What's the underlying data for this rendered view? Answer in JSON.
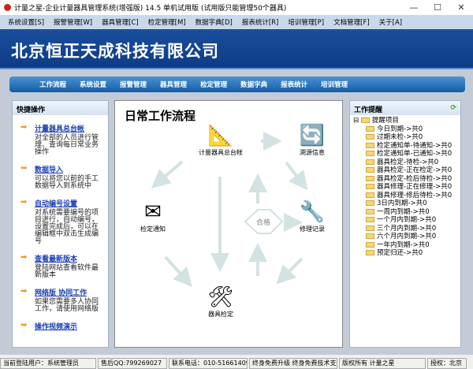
{
  "window": {
    "title": "计量之星-企业计量器具管理系统(增强版) 14.5 单机试用版  (试用版只能管理50个器具)",
    "min": "—",
    "max": "☐",
    "close": "✕"
  },
  "menu": [
    "系统设置[S]",
    "报警管理[W]",
    "器具管理[C]",
    "检定管理[M]",
    "数据字典[D]",
    "报表统计[R]",
    "培训管理[P]",
    "文档管理[F]",
    "关于[A]"
  ],
  "banner": "北京恒正天成科技有限公司",
  "nav": [
    "工作流程",
    "系统设置",
    "报警管理",
    "器具管理",
    "检定管理",
    "数据字典",
    "报表统计",
    "培训管理"
  ],
  "quick": {
    "title": "快捷操作",
    "items": [
      {
        "link": "计量器具总台帐",
        "desc": "对全部的人员进行管理、查询每日常业务操作"
      },
      {
        "link": "数据导入",
        "desc": "可以将您以前的手工数据导入到系统中"
      },
      {
        "link": "自动编号设置",
        "desc": "对系统需要编号的项目进行，自动编号，设置完成后，可以在编辑框中双击生成编号"
      },
      {
        "link": "查看最新版本",
        "desc": "登陆网站查看软件最新版本"
      },
      {
        "link": "网络版  协同工作",
        "desc": "如果您需要多人协同工作，请使用网络版"
      },
      {
        "link": "操作视频演示",
        "desc": ""
      }
    ]
  },
  "flow": {
    "title": "日常工作流程",
    "nodes": {
      "ledger": "计量器具总台帐",
      "trace": "溯源信息",
      "notice": "检定通知",
      "repair": "修理记录",
      "check": "器具检定",
      "pass": "合格"
    }
  },
  "reminder": {
    "title": "工作提醒",
    "root": "提醒项目",
    "items": [
      "今日到期->共0",
      "过期未检->共0",
      "检定通知单-待通知->共0",
      "检定通知单-已通知->共0",
      "器具检定-待检->共0",
      "器具检定-正在检定->共0",
      "器具检定-检后待检->共0",
      "器具修理-正在修理->共0",
      "器具修理-修后待检->共0",
      "3日内到期->共0",
      "一周内到期->共0",
      "一个月内到期->共0",
      "三个月内到期->共0",
      "六个月内到期->共0",
      "一年内到期->共0",
      "预定归还->共0"
    ]
  },
  "status": [
    "当前登陆用户：系统管理员",
    "售后QQ:799269027",
    "联系电话：010-51661409",
    "终身免费升级 终身免费技术支持",
    "版权所有 计量之星",
    "授权：北京"
  ]
}
